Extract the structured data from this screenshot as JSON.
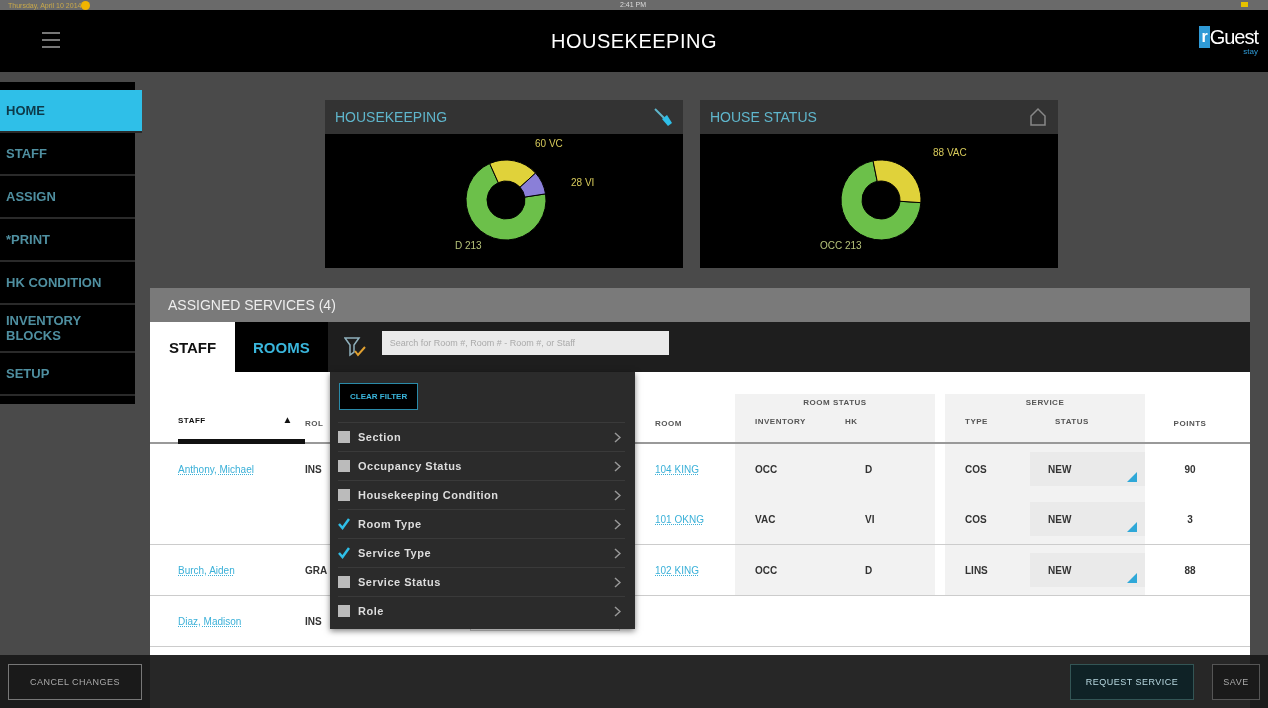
{
  "status_bar": {
    "date": "Thursday, April 10 2014",
    "time": "2:41 PM"
  },
  "header": {
    "title": "HOUSEKEEPING",
    "logo": {
      "mark": "r",
      "name": "Guest",
      "sub": "stay"
    }
  },
  "sidebar": {
    "items": [
      {
        "label": "HOME",
        "selected": true
      },
      {
        "label": "STAFF",
        "selected": false
      },
      {
        "label": "ASSIGN",
        "selected": false
      },
      {
        "label": "*PRINT",
        "selected": false
      },
      {
        "label": "HK CONDITION",
        "selected": false
      },
      {
        "label": "INVENTORY BLOCKS",
        "selected": false
      },
      {
        "label": "SETUP",
        "selected": false
      }
    ]
  },
  "cards": [
    {
      "title": "HOUSEKEEPING",
      "chart_data": {
        "type": "donut",
        "categories": [
          "D 213",
          "60 VC",
          "28 VI"
        ],
        "values": [
          213,
          60,
          28
        ]
      }
    },
    {
      "title": "HOUSE STATUS",
      "chart_data": {
        "type": "donut",
        "categories": [
          "OCC 213",
          "88 VAC"
        ],
        "values": [
          213,
          88
        ]
      }
    }
  ],
  "assigned_services": {
    "title": "ASSIGNED SERVICES (4)",
    "tabs": [
      {
        "label": "STAFF",
        "selected": true
      },
      {
        "label": "ROOMS",
        "selected": false
      }
    ],
    "search": {
      "placeholder": "Search for Room #, Room # - Room #, or Staff"
    },
    "filter_menu": {
      "clear_button": "CLEAR FILTER",
      "items": [
        {
          "label": "Section",
          "checked": false
        },
        {
          "label": "Occupancy Status",
          "checked": false
        },
        {
          "label": "Housekeeping Condition",
          "checked": false
        },
        {
          "label": "Room Type",
          "checked": true
        },
        {
          "label": "Service Type",
          "checked": true
        },
        {
          "label": "Service Status",
          "checked": false
        },
        {
          "label": "Role",
          "checked": false
        }
      ]
    },
    "table": {
      "columns": {
        "staff": "STAFF",
        "sort_indicator": "▲",
        "role": "ROL",
        "room": "ROOM",
        "room_status": "ROOM STATUS",
        "inventory": "INVENTORY",
        "hk": "HK",
        "service": "SERVICE",
        "type": "TYPE",
        "status": "STATUS",
        "points": "POINTS"
      },
      "rows": [
        {
          "staff": "Anthony, Michael",
          "role": "INS",
          "rooms": [
            {
              "room": "104 KING",
              "inventory": "OCC",
              "hk": "D",
              "type": "COS",
              "status": "NEW",
              "points": "90"
            },
            {
              "room": "101 OKNG",
              "inventory": "VAC",
              "hk": "VI",
              "type": "COS",
              "status": "NEW",
              "points": "3"
            }
          ]
        },
        {
          "staff": "Burch, Aiden",
          "role": "GRA",
          "rooms": [
            {
              "room": "102 KING",
              "inventory": "OCC",
              "hk": "D",
              "type": "LINS",
              "status": "NEW",
              "points": "88"
            }
          ]
        },
        {
          "staff": "Diaz, Madison",
          "role": "INS",
          "rooms": []
        }
      ]
    }
  },
  "actions": {
    "cancel": "CANCEL CHANGES",
    "request": "REQUEST SERVICE",
    "save": "SAVE"
  }
}
